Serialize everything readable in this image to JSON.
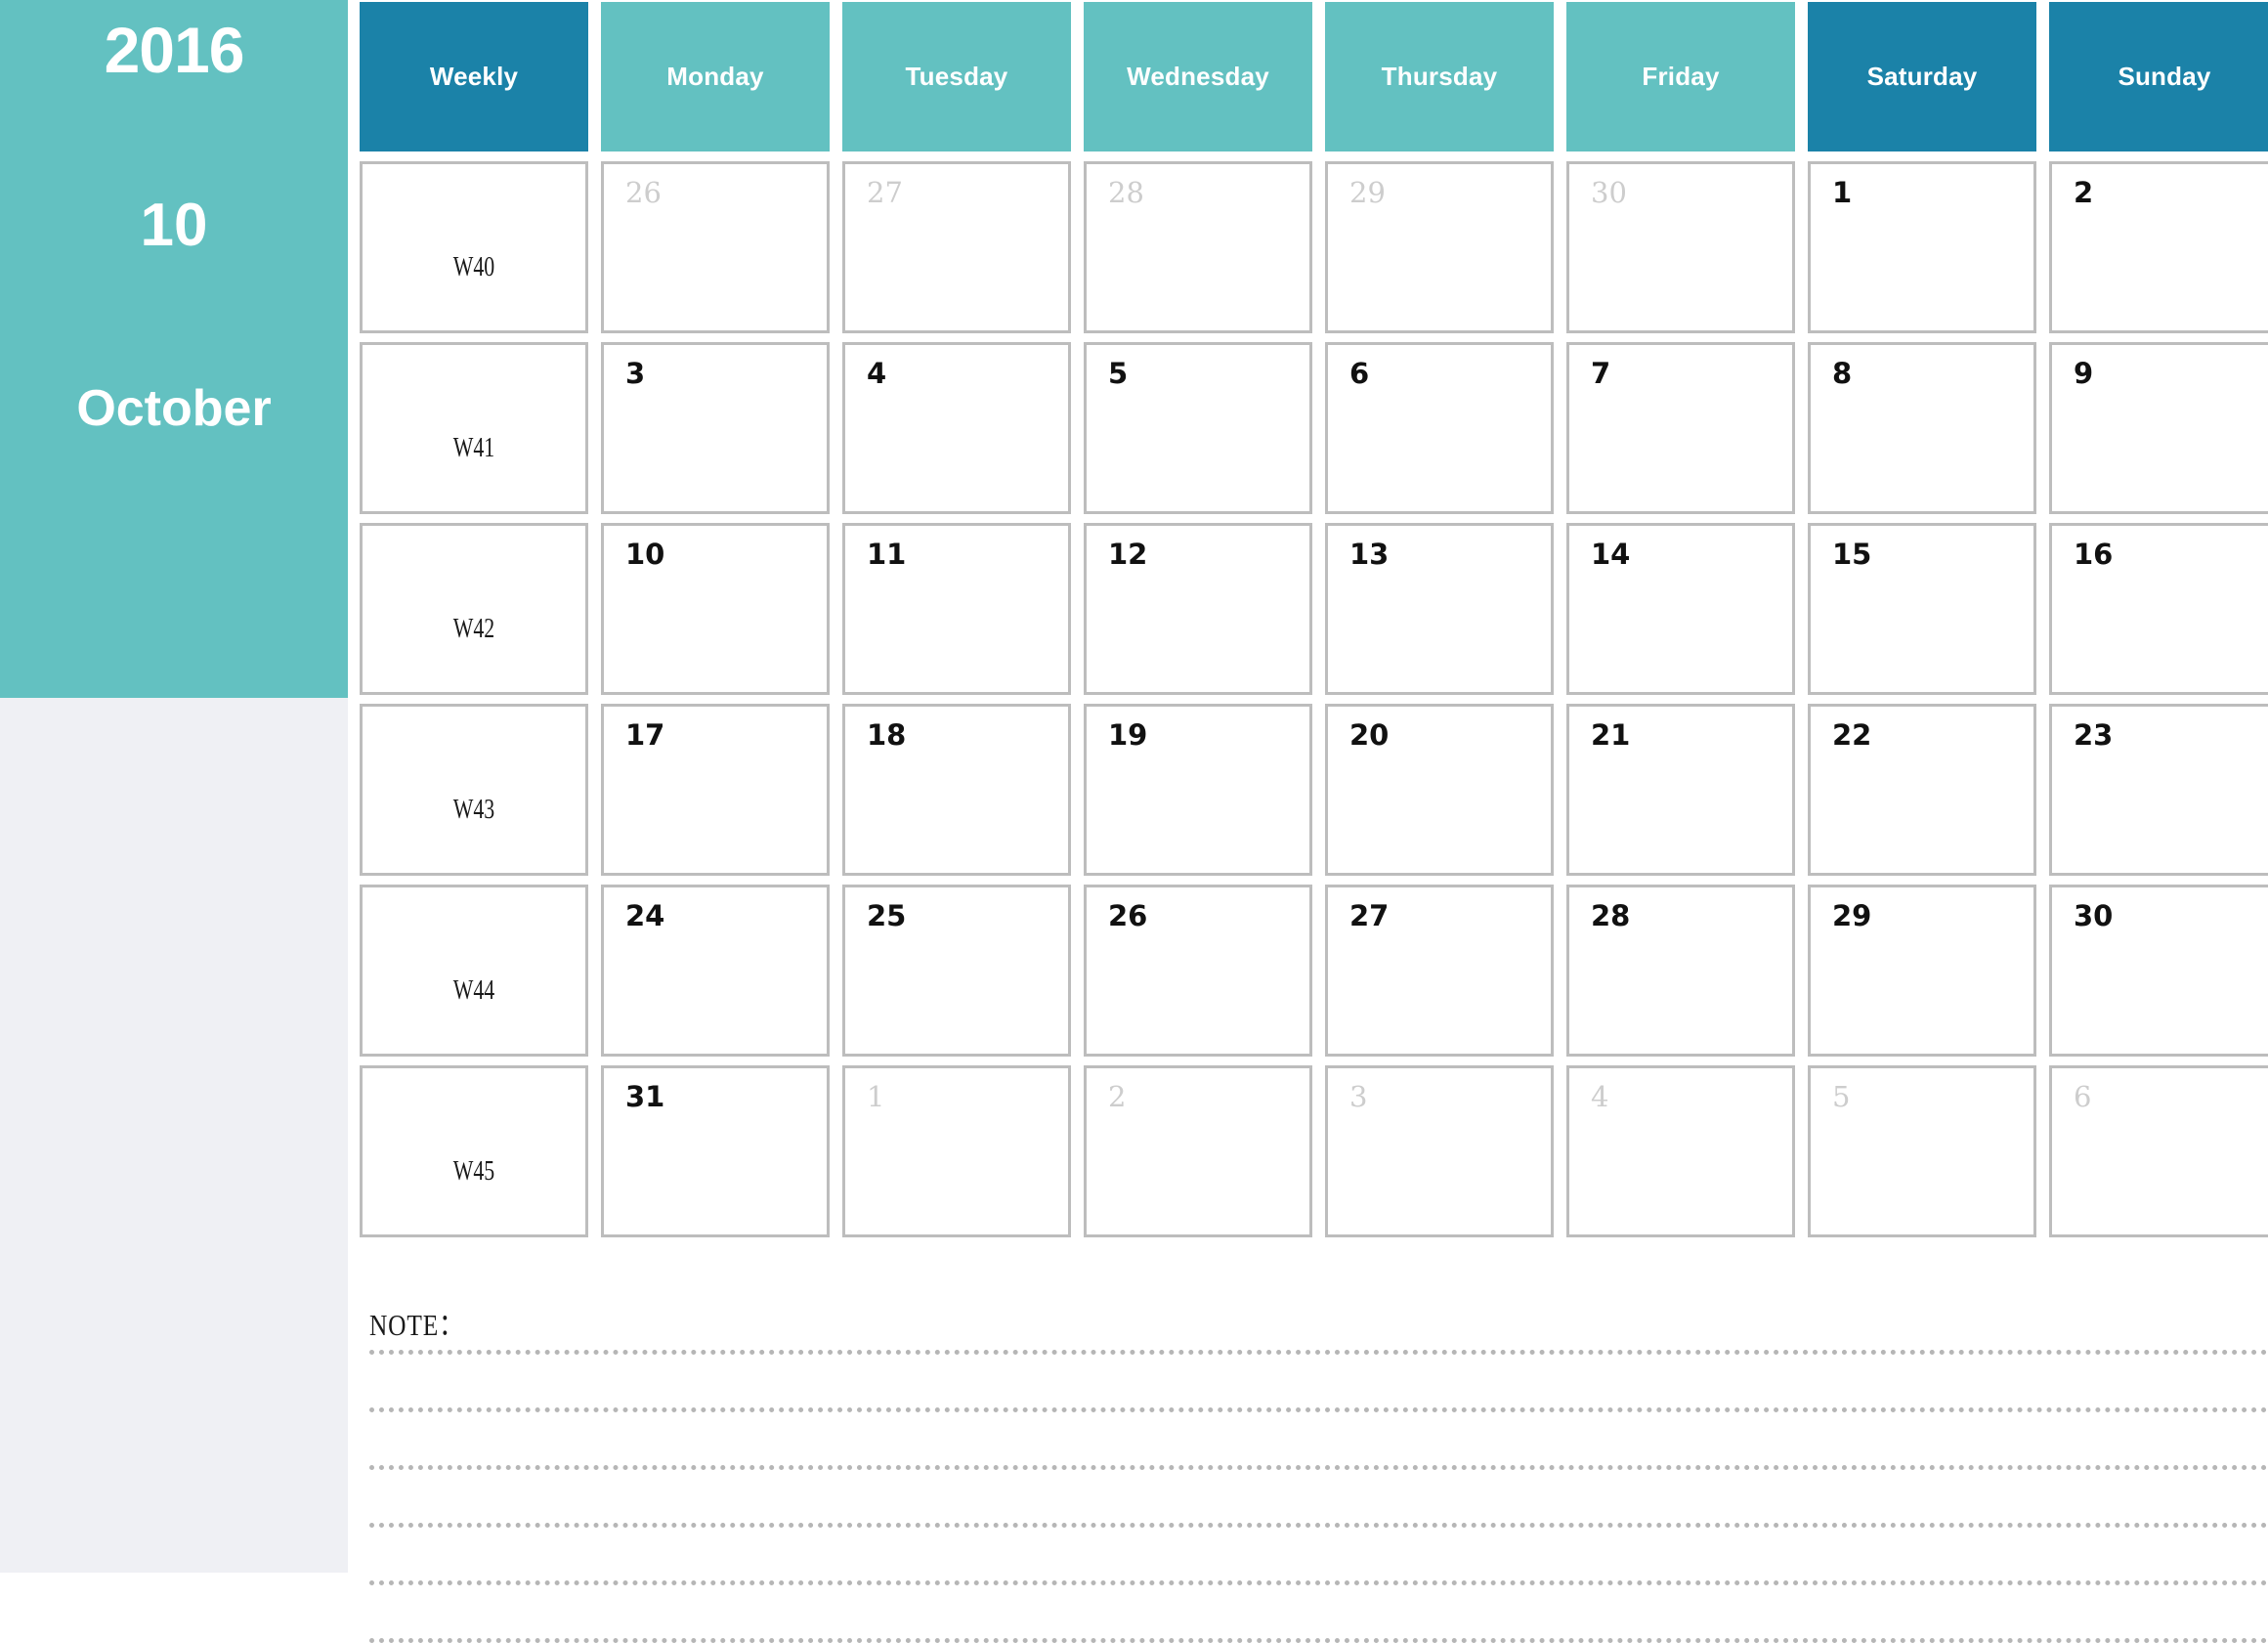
{
  "sidebar": {
    "year": "2016",
    "month_number": "10",
    "month_name": "October",
    "bg_color": "#63c1c1",
    "below_color": "#eff0f4"
  },
  "calendar": {
    "accent_light": "#63c1c1",
    "accent_dark": "#1b82a8",
    "border_color": "#bdbdbd",
    "muted_date_color": "#cdcdcd",
    "headers": [
      {
        "label": "Weekly",
        "style": "dark"
      },
      {
        "label": "Monday",
        "style": "light"
      },
      {
        "label": "Tuesday",
        "style": "light"
      },
      {
        "label": "Wednesday",
        "style": "light"
      },
      {
        "label": "Thursday",
        "style": "light"
      },
      {
        "label": "Friday",
        "style": "light"
      },
      {
        "label": "Saturday",
        "style": "dark"
      },
      {
        "label": "Sunday",
        "style": "dark"
      }
    ],
    "weeks": [
      {
        "week_label": "W40",
        "days": [
          {
            "num": "26",
            "muted": true
          },
          {
            "num": "27",
            "muted": true
          },
          {
            "num": "28",
            "muted": true
          },
          {
            "num": "29",
            "muted": true
          },
          {
            "num": "30",
            "muted": true
          },
          {
            "num": "1",
            "muted": false
          },
          {
            "num": "2",
            "muted": false
          }
        ]
      },
      {
        "week_label": "W41",
        "days": [
          {
            "num": "3",
            "muted": false
          },
          {
            "num": "4",
            "muted": false
          },
          {
            "num": "5",
            "muted": false
          },
          {
            "num": "6",
            "muted": false
          },
          {
            "num": "7",
            "muted": false
          },
          {
            "num": "8",
            "muted": false
          },
          {
            "num": "9",
            "muted": false
          }
        ]
      },
      {
        "week_label": "W42",
        "days": [
          {
            "num": "10",
            "muted": false
          },
          {
            "num": "11",
            "muted": false
          },
          {
            "num": "12",
            "muted": false
          },
          {
            "num": "13",
            "muted": false
          },
          {
            "num": "14",
            "muted": false
          },
          {
            "num": "15",
            "muted": false
          },
          {
            "num": "16",
            "muted": false
          }
        ]
      },
      {
        "week_label": "W43",
        "days": [
          {
            "num": "17",
            "muted": false
          },
          {
            "num": "18",
            "muted": false
          },
          {
            "num": "19",
            "muted": false
          },
          {
            "num": "20",
            "muted": false
          },
          {
            "num": "21",
            "muted": false
          },
          {
            "num": "22",
            "muted": false
          },
          {
            "num": "23",
            "muted": false
          }
        ]
      },
      {
        "week_label": "W44",
        "days": [
          {
            "num": "24",
            "muted": false
          },
          {
            "num": "25",
            "muted": false
          },
          {
            "num": "26",
            "muted": false
          },
          {
            "num": "27",
            "muted": false
          },
          {
            "num": "28",
            "muted": false
          },
          {
            "num": "29",
            "muted": false
          },
          {
            "num": "30",
            "muted": false
          }
        ]
      },
      {
        "week_label": "W45",
        "days": [
          {
            "num": "31",
            "muted": false
          },
          {
            "num": "1",
            "muted": true
          },
          {
            "num": "2",
            "muted": true
          },
          {
            "num": "3",
            "muted": true
          },
          {
            "num": "4",
            "muted": true
          },
          {
            "num": "5",
            "muted": true
          },
          {
            "num": "6",
            "muted": true
          }
        ]
      }
    ]
  },
  "note": {
    "label": "NOTE：",
    "line_count": 6
  }
}
